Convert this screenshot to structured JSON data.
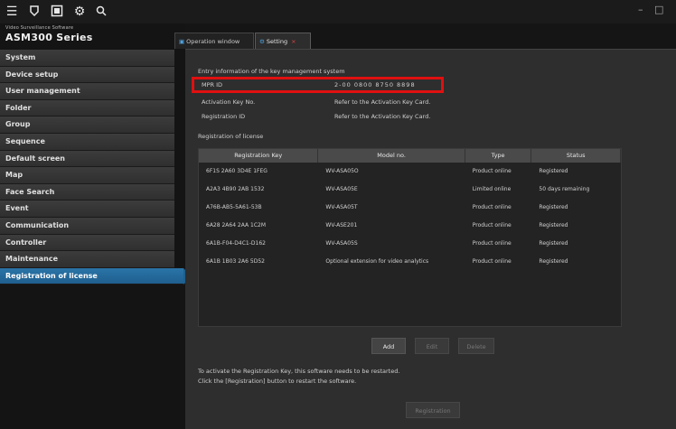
{
  "toolbar": {
    "icons": [
      "menu-icon",
      "shield-icon",
      "screen-icon",
      "gear-icon",
      "search-icon"
    ],
    "minimize": "–",
    "maximize": "□"
  },
  "brand": {
    "subtitle": "Video Surveillance Software",
    "name": "ASM300 Series"
  },
  "menu": [
    {
      "label": "System"
    },
    {
      "label": "Device setup"
    },
    {
      "label": "User management"
    },
    {
      "label": "Folder"
    },
    {
      "label": "Group"
    },
    {
      "label": "Sequence"
    },
    {
      "label": "Default screen"
    },
    {
      "label": "Map"
    },
    {
      "label": "Face Search"
    },
    {
      "label": "Event"
    },
    {
      "label": "Communication"
    },
    {
      "label": "Controller"
    },
    {
      "label": "Maintenance"
    },
    {
      "label": "Registration of license"
    }
  ],
  "tabs": {
    "operation": "Operation window",
    "setting": "Setting",
    "close": "×"
  },
  "license": {
    "section_title": "Entry information of the key management system",
    "mpr_label": "MPR ID",
    "mpr_value": "2-00 0800 8750 8898",
    "activation_label": "Activation Key No.",
    "activation_value": "Refer to the Activation Key Card.",
    "registration_label": "Registration ID",
    "registration_value": "Refer to the Activation Key Card.",
    "table_title": "Registration of license"
  },
  "table": {
    "headers": [
      "Registration Key",
      "Model no.",
      "Type",
      "Status"
    ],
    "rows": [
      [
        "6F1S 2A60 3D4E 1FEG",
        "WV-ASA05O",
        "Product online",
        "Registered"
      ],
      [
        "A2A3 4B90 2AB 1532",
        "WV-ASA05E",
        "Limited online",
        "50 days remaining"
      ],
      [
        "A76B-AB5-5A61-53B",
        "WV-ASA05T",
        "Product online",
        "Registered"
      ],
      [
        "6A28 2A64 2AA 1C2M",
        "WV-ASE201",
        "Product online",
        "Registered"
      ],
      [
        "6A1B-F04-D4C1-D162",
        "WV-ASA05S",
        "Product online",
        "Registered"
      ],
      [
        "6A1B 1B03 2A6 5D52",
        "Optional extension for video analytics",
        "Product online",
        "Registered"
      ]
    ]
  },
  "buttons": {
    "add": "Add",
    "edit": "Edit",
    "delete": "Delete",
    "registration": "Registration"
  },
  "notes": {
    "line1": "To activate the Registration Key, this software needs to be restarted.",
    "line2": "Click the [Registration] button to restart the software."
  },
  "colors": {
    "accent": "#2a74a8",
    "highlight": "#e01010",
    "background": "#2e2e2e"
  }
}
